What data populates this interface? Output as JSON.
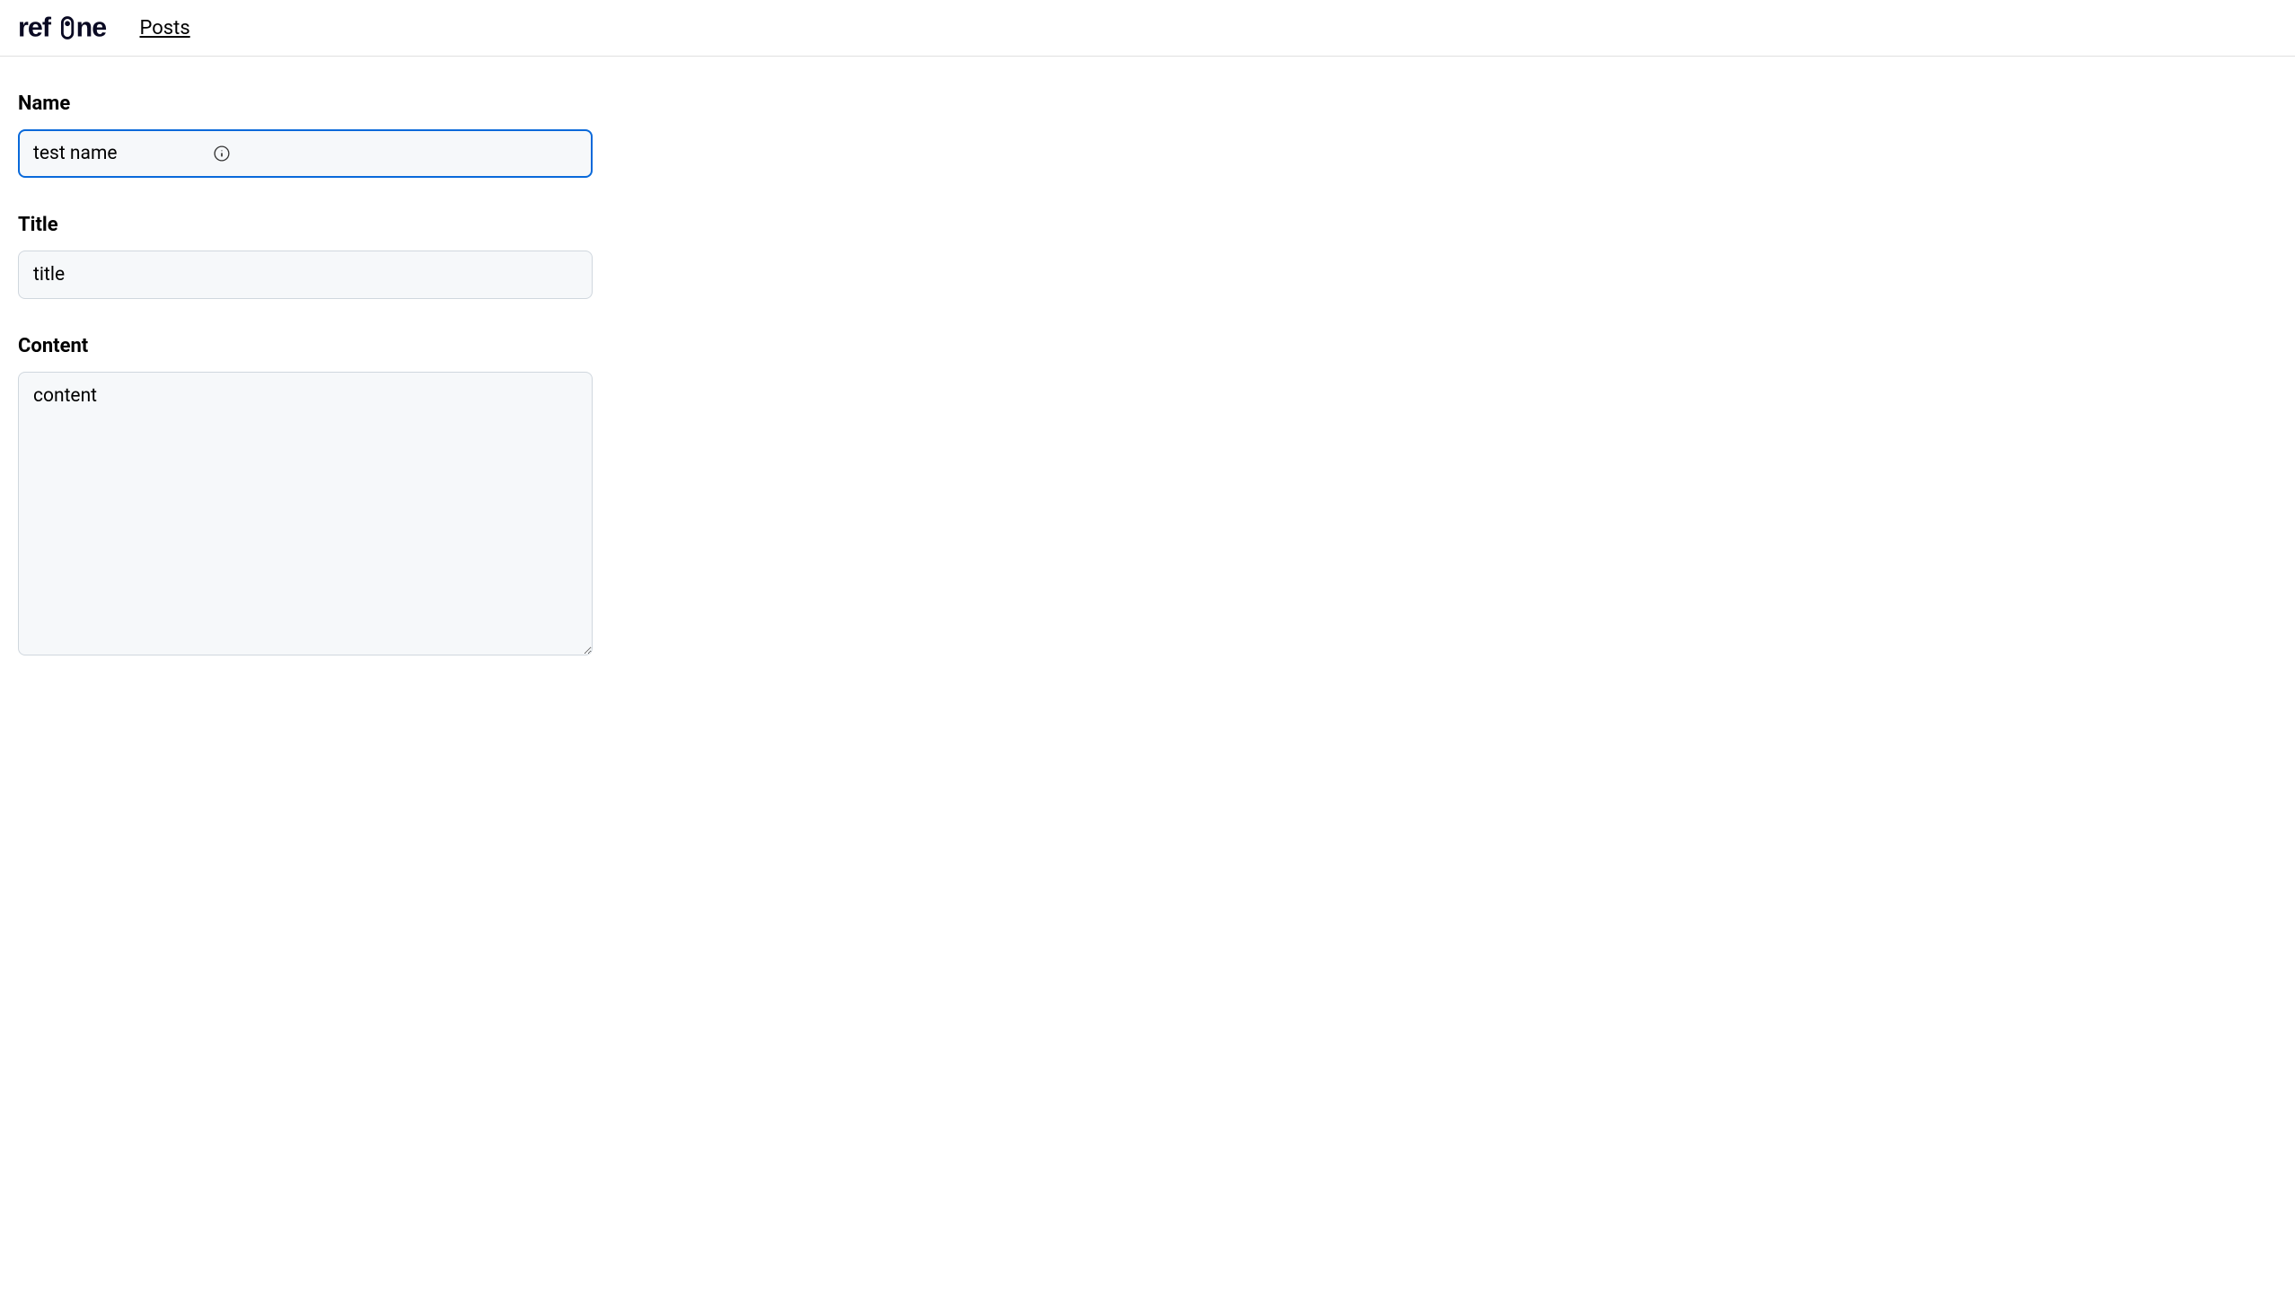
{
  "header": {
    "logo_text": "refine",
    "nav_link": "Posts"
  },
  "form": {
    "name": {
      "label": "Name",
      "value": "test name",
      "focused": true
    },
    "title": {
      "label": "Title",
      "value": "title"
    },
    "content": {
      "label": "Content",
      "value": "content"
    }
  }
}
